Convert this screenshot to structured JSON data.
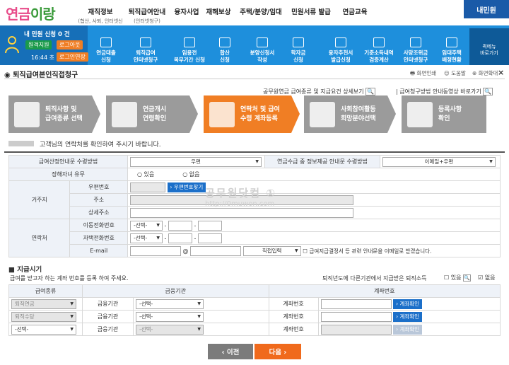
{
  "logo": {
    "text_a": "연금",
    "text_b": "이랑"
  },
  "topnav": [
    {
      "label": "재직정보",
      "sub": "(협산, 사퇴, 인터넷신청)"
    },
    {
      "label": "퇴직급여안내",
      "sub": "(인터넷청구)"
    },
    {
      "label": "융자사업",
      "sub": ""
    },
    {
      "label": "재해보상",
      "sub": ""
    },
    {
      "label": "주택/분양/임대",
      "sub": ""
    },
    {
      "label": "민원서류 발급",
      "sub": ""
    },
    {
      "label": "연금교육",
      "sub": ""
    }
  ],
  "mypage": "내민원",
  "user": {
    "status": "내 민원 신청 0 건",
    "btn_remote": "원격지원",
    "btn_logout": "로그아웃",
    "time": "16:44 초",
    "btn_extend": "로그인연장"
  },
  "quickmenu": [
    {
      "l1": "연금대출",
      "l2": "신청"
    },
    {
      "l1": "퇴직급여",
      "l2": "인터넷청구"
    },
    {
      "l1": "임용전",
      "l2": "복무기간 신청"
    },
    {
      "l1": "합산",
      "l2": "신청"
    },
    {
      "l1": "분양신청서",
      "l2": "작성"
    },
    {
      "l1": "학자금",
      "l2": "신청"
    },
    {
      "l1": "융자추천서",
      "l2": "발급신청"
    },
    {
      "l1": "기준소득내역",
      "l2": "검증계산"
    },
    {
      "l1": "사망조위금",
      "l2": "인터넷청구"
    },
    {
      "l1": "임대주택",
      "l2": "배정현황"
    }
  ],
  "quickmore": {
    "l1": "퀵메뉴",
    "l2": "바로가기"
  },
  "page_title": "퇴직급여본인직접청구",
  "tools": {
    "print": "화면인쇄",
    "help": "도움말",
    "zoom": "화면확대",
    "close": "×"
  },
  "links": {
    "detail": "공무원연금 급여종류 및 지급요건 상세보기",
    "video": "급여청구방법 안내동영상 바로가기"
  },
  "steps": [
    {
      "l1": "퇴직사항 및",
      "l2": "급여종류 선택"
    },
    {
      "l1": "연금개시",
      "l2": "연령확인"
    },
    {
      "l1": "연락처 및 급여",
      "l2": "수령 계좌등록"
    },
    {
      "l1": "사회참여활동",
      "l2": "희망분야선택"
    },
    {
      "l1": "등록사항",
      "l2": "확인"
    }
  ],
  "greeting": "고객님의 연락처를 확인하여 주시기 바랍니다.",
  "contact": {
    "notice_method_label": "급여산정안내문 수령방법",
    "notice_method_value": "우편",
    "info_method_label": "연금수급 중 정보제공 안내문 수령방법",
    "info_method_value": "이메일+우편",
    "disability_label": "장해자녀 유무",
    "disability_yes": "있음",
    "disability_no": "없음",
    "residence_label": "거주지",
    "zip_label": "우편번호",
    "zip_button": "› 우편번호찾기",
    "addr_label": "주소",
    "addr_detail_label": "상세주소",
    "contact_label": "연락처",
    "mobile_label": "이동전화번호",
    "home_label": "자택전화번호",
    "select_placeholder": "-선택-",
    "email_label": "E-mail",
    "email_at": "@",
    "email_domain": "직접입력",
    "email_note": "급여지급결정서 등 관련 안내문을 이메일로 받겠습니다."
  },
  "watermark": {
    "line1": "공무원닷컴 ①",
    "line2": "http://0muwon.com"
  },
  "payment": {
    "title": "지급시기",
    "desc": "급여를 받고자 하는 계좌 번호를 등록 하여 주세요.",
    "retire_q": "퇴직년도에 다른기관에서 지급받은 퇴직소득",
    "yes": "있음",
    "no": "없음",
    "headers": {
      "type": "급여종류",
      "bank": "금융기관",
      "account": "계좌번호"
    },
    "rows": [
      {
        "type": "퇴직연금",
        "bank_label": "금융기관",
        "bank_value": "-선택-",
        "acct_label": "계좌번호",
        "btn": "› 계좌확인"
      },
      {
        "type": "퇴직수당",
        "bank_label": "금융기관",
        "bank_value": "-선택-",
        "acct_label": "계좌번호",
        "btn": "› 계좌확인"
      },
      {
        "type": "-선택-",
        "bank_label": "금융기관",
        "bank_value": "-선택-",
        "acct_label": "계좌번호",
        "btn": "› 계좌확인"
      }
    ]
  },
  "nav": {
    "prev": "‹ 이전",
    "next": "다음 ›"
  }
}
